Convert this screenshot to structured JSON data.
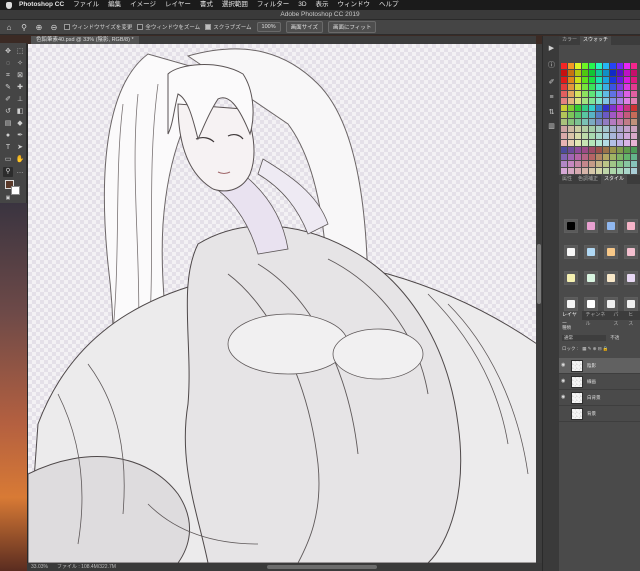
{
  "menubar": {
    "app_name": "Photoshop CC",
    "items": [
      "ファイル",
      "編集",
      "イメージ",
      "レイヤー",
      "書式",
      "選択範囲",
      "フィルター",
      "3D",
      "表示",
      "ウィンドウ",
      "ヘルプ"
    ]
  },
  "window": {
    "title": "Adobe Photoshop CC 2019"
  },
  "options": {
    "resize_windows": "ウィンドウサイズを変更",
    "zoom_all": "全ウィンドウをズーム",
    "scrubby_zoom": "スクラブズーム",
    "zoom_100": "100%",
    "fit_screen": "画面サイズ",
    "fill_screen": "画面にフィット"
  },
  "document": {
    "tab_label": "色鉛筆素40.psd @ 33% (陰影, RGB/8) *"
  },
  "status": {
    "zoom": "33.03%",
    "file_info": "ファイル : 108.4M/322.7M"
  },
  "panels": {
    "color_tabs": [
      "カラー",
      "スウォッチ"
    ],
    "style_tabs": [
      "属性",
      "色調補正",
      "スタイル"
    ],
    "layer_tabs": [
      "レイヤー",
      "チャンネル",
      "パス",
      "ヒス"
    ],
    "blend_mode": "通常",
    "opacity_label": "不透",
    "lock_label": "ロック :",
    "kind_label": "種類",
    "layers": [
      "陰影",
      "線画",
      "白背景",
      "背景"
    ]
  },
  "colors": {
    "accent": "#3b7bd8",
    "panel_bg": "#4a4a4a",
    "canvas_bg": "#f3f1f4"
  }
}
